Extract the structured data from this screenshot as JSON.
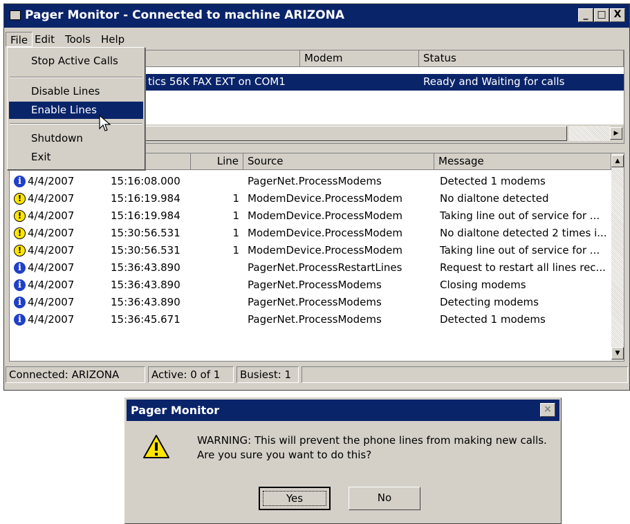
{
  "window": {
    "title": "Pager Monitor - Connected to machine ARIZONA",
    "buttons": [
      "_",
      "□",
      "X"
    ]
  },
  "menubar": [
    "File",
    "Edit",
    "Tools",
    "Help"
  ],
  "file_menu": {
    "items": [
      "Stop Active Calls",
      "Disable Lines",
      "Enable Lines",
      "Shutdown",
      "Exit"
    ],
    "highlighted": "Enable Lines"
  },
  "lines_list": {
    "headers": [
      "Modem",
      "Status"
    ],
    "row": {
      "modem": "tics 56K FAX EXT on COM1",
      "status": "Ready and Waiting for calls"
    }
  },
  "log": {
    "headers": [
      "Line",
      "Source",
      "Message"
    ],
    "rows": [
      {
        "icon": "info-icon",
        "date": "4/4/2007",
        "time": "15:16:08.000",
        "line": "",
        "source": "PagerNet.ProcessModems",
        "message": "Detected 1  modems"
      },
      {
        "icon": "warning-icon",
        "date": "4/4/2007",
        "time": "15:16:19.984",
        "line": "1",
        "source": "ModemDevice.ProcessModem",
        "message": "No dialtone detected"
      },
      {
        "icon": "warning-icon",
        "date": "4/4/2007",
        "time": "15:16:19.984",
        "line": "1",
        "source": "ModemDevice.ProcessModem",
        "message": "Taking line out of service for ..."
      },
      {
        "icon": "warning-icon",
        "date": "4/4/2007",
        "time": "15:30:56.531",
        "line": "1",
        "source": "ModemDevice.ProcessModem",
        "message": "No dialtone detected 2 times i..."
      },
      {
        "icon": "warning-icon",
        "date": "4/4/2007",
        "time": "15:30:56.531",
        "line": "1",
        "source": "ModemDevice.ProcessModem",
        "message": "Taking line out of service for ..."
      },
      {
        "icon": "info-icon",
        "date": "4/4/2007",
        "time": "15:36:43.890",
        "line": "",
        "source": "PagerNet.ProcessRestartLines",
        "message": "Request to restart all lines rec..."
      },
      {
        "icon": "info-icon",
        "date": "4/4/2007",
        "time": "15:36:43.890",
        "line": "",
        "source": "PagerNet.ProcessModems",
        "message": "Closing modems"
      },
      {
        "icon": "info-icon",
        "date": "4/4/2007",
        "time": "15:36:43.890",
        "line": "",
        "source": "PagerNet.ProcessModems",
        "message": "Detecting modems"
      },
      {
        "icon": "info-icon",
        "date": "4/4/2007",
        "time": "15:36:45.671",
        "line": "",
        "source": "PagerNet.ProcessModems",
        "message": "Detected 1  modems"
      }
    ]
  },
  "statusbar": {
    "connected": "Connected: ARIZONA",
    "active": "Active: 0 of 1",
    "busiest": "Busiest: 1"
  },
  "dialog": {
    "title": "Pager Monitor",
    "close": "×",
    "line1": "WARNING: This will prevent the phone lines from making new calls.",
    "line2": "Are you sure you want to do this?",
    "yes": "Yes",
    "no": "No"
  },
  "colors": {
    "titlebar": "#0a246a",
    "face": "#d4d0c8",
    "selection": "#0a246a"
  }
}
